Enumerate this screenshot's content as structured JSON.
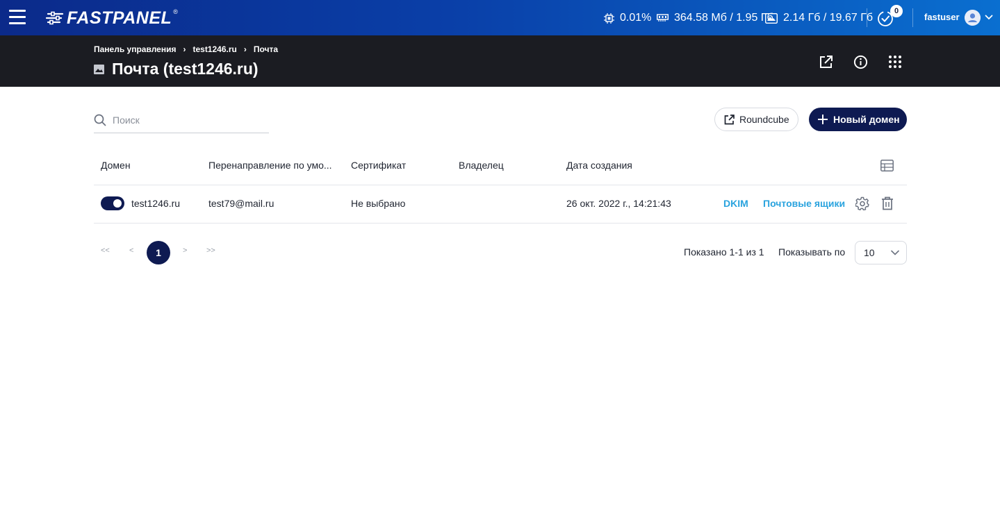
{
  "header": {
    "logo_text": "FASTPANEL",
    "logo_reg": "®",
    "cpu": "0.01%",
    "ram": "364.58 Мб / 1.95 Гб",
    "disk": "2.14 Гб / 19.67 Гб",
    "tasks_count": "0",
    "username": "fastuser"
  },
  "page": {
    "breadcrumbs": [
      "Панель управления",
      "test1246.ru",
      "Почта"
    ],
    "title": "Почта (test1246.ru)"
  },
  "toolbar": {
    "search_placeholder": "Поиск",
    "roundcube_label": "Roundcube",
    "new_domain_label": "Новый домен"
  },
  "table": {
    "columns": [
      "Домен",
      "Перенаправление по умо...",
      "Сертификат",
      "Владелец",
      "Дата создания"
    ],
    "rows": [
      {
        "enabled": true,
        "domain": "test1246.ru",
        "redirect": "test79@mail.ru",
        "certificate": "Не выбрано",
        "owner": "",
        "created": "26 окт. 2022 г., 14:21:43",
        "dkim_label": "DKIM",
        "mailboxes_label": "Почтовые ящики"
      }
    ]
  },
  "pagination": {
    "first": "<<",
    "prev": "<",
    "current": "1",
    "next": ">",
    "last": ">>",
    "shown": "Показано 1-1 из 1",
    "per_page_label": "Показывать по",
    "per_page_value": "10"
  },
  "colors": {
    "primary": "#0e1a52",
    "link": "#2aa3de",
    "header_dark": "#1b1c22"
  }
}
